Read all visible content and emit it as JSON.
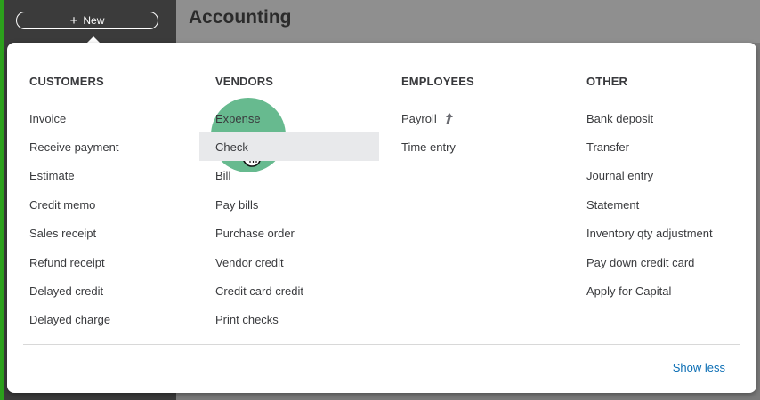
{
  "topbar": {
    "new_button_label": "New",
    "page_title": "Accounting"
  },
  "menu": {
    "columns": [
      {
        "header": "CUSTOMERS",
        "items": [
          "Invoice",
          "Receive payment",
          "Estimate",
          "Credit memo",
          "Sales receipt",
          "Refund receipt",
          "Delayed credit",
          "Delayed charge"
        ]
      },
      {
        "header": "VENDORS",
        "items": [
          "Expense",
          "Check",
          "Bill",
          "Pay bills",
          "Purchase order",
          "Vendor credit",
          "Credit card credit",
          "Print checks"
        ]
      },
      {
        "header": "EMPLOYEES",
        "items": [
          "Payroll",
          "Time entry"
        ]
      },
      {
        "header": "OTHER",
        "items": [
          "Bank deposit",
          "Transfer",
          "Journal entry",
          "Statement",
          "Inventory qty adjustment",
          "Pay down credit card",
          "Apply for Capital"
        ]
      }
    ],
    "hovered_item": "Check",
    "show_less_label": "Show less"
  },
  "icons": {
    "new": "plus-icon",
    "payroll_badge": "up-arrow-icon",
    "cursor": "hand-pointer-icon"
  },
  "colors": {
    "accent_green": "#2ca01c",
    "link_blue": "#0d6fb5",
    "sidebar": "#3b3b3b",
    "text": "#393a3d",
    "hover_row": "#e8e9eb",
    "click_highlight": "#2ca064"
  }
}
